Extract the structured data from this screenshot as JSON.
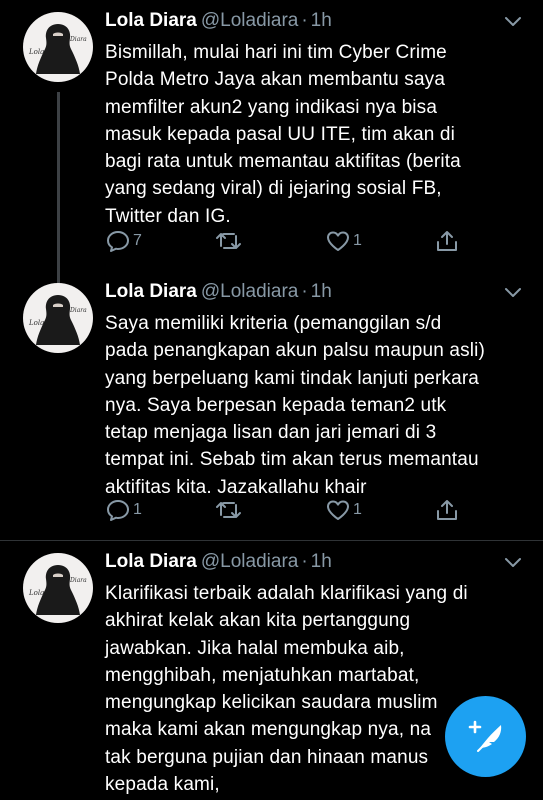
{
  "tweets": [
    {
      "name": "Lola Diara",
      "handle": "@Loladiara",
      "separator": "·",
      "time": "1h",
      "lines": [
        "Bismillah, mulai hari ini tim Cyber Crime",
        "Polda Metro Jaya akan membantu saya",
        "memfilter akun2 yang indikasi nya bisa",
        "masuk kepada pasal UU ITE, tim akan di",
        "bagi rata untuk memantau aktifitas (berita",
        "yang sedang viral) di jejaring sosial FB,",
        "Twitter dan IG."
      ],
      "replies": "7",
      "retweets": "",
      "likes": "1"
    },
    {
      "name": "Lola Diara",
      "handle": "@Loladiara",
      "separator": "·",
      "time": "1h",
      "lines": [
        "Saya memiliki kriteria (pemanggilan s/d",
        "pada penangkapan akun palsu maupun asli)",
        "yang berpeluang kami tindak lanjuti perkara",
        "nya. Saya berpesan kepada teman2 utk",
        "tetap menjaga lisan dan jari jemari di 3",
        "tempat ini. Sebab tim akan terus memantau",
        "aktifitas kita. Jazakallahu khair"
      ],
      "replies": "1",
      "retweets": "",
      "likes": "1"
    },
    {
      "name": "Lola Diara",
      "handle": "@Loladiara",
      "separator": "·",
      "time": "1h",
      "lines": [
        "Klarifikasi terbaik adalah klarifikasi yang di",
        "akhirat kelak akan kita pertanggung",
        "jawabkan. Jika halal membuka aib,",
        "mengghibah, menjatuhkan martabat,",
        "mengungkap kelicikan saudara muslim",
        "maka kami akan mengungkap nya, na",
        "tak berguna pujian dan hinaan manus",
        "kepada kami,"
      ]
    }
  ],
  "avatar": {
    "script_text": "Lola Diara",
    "background_color": "#f2f0ef",
    "figure_color": "#1a1a1a"
  },
  "compose_button": {
    "icon": "compose-feather-plus-icon",
    "color": "#1da1f2"
  },
  "colors": {
    "background": "#000000",
    "text_primary": "#ffffff",
    "text_secondary": "#8899a6",
    "divider": "#2f3336",
    "thread_line": "#3d4145"
  }
}
